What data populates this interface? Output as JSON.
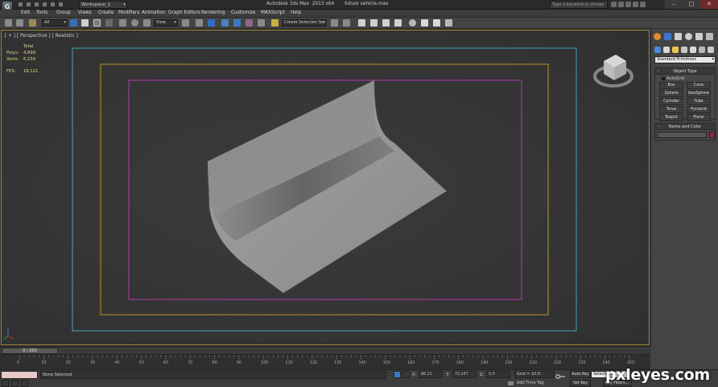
{
  "titlebar": {
    "workspace": "Workspace_1",
    "window_title": "Autodesk 3ds Max  2013 x64       future vehicle.max",
    "help_placeholder": "Type a keyword or phrase",
    "logo_glyph": "G"
  },
  "menu": [
    "Edit",
    "Tools",
    "Group",
    "Views",
    "Create",
    "Modifiers",
    "Animation",
    "Graph Editors",
    "Rendering",
    "Customize",
    "MAXScript",
    "Help"
  ],
  "toolbar": {
    "selection_filter": "All",
    "reference_coord": "View",
    "named_selection_set": "Create Selection Se"
  },
  "viewport": {
    "label": "[ + ] [ Perspective ] [ Realistic ]",
    "stats": [
      {
        "label": "",
        "value": "Total"
      },
      {
        "label": "Polys:",
        "value": "4,899"
      },
      {
        "label": "Verts:",
        "value": "6,156"
      },
      {
        "label": "FPS:",
        "value": "18.121"
      }
    ]
  },
  "command_panel": {
    "category_dropdown": "Standard Primitives",
    "object_type_title": "Object Type",
    "autogrid_label": "AutoGrid",
    "buttons": [
      "Box",
      "Cone",
      "Sphere",
      "GeoSphere",
      "Cylinder",
      "Tube",
      "Torus",
      "Pyramid",
      "Teapot",
      "Plane"
    ],
    "name_color_title": "Name and Color",
    "rollout_sign": "-",
    "swatch_color": "#a0263e"
  },
  "timeline": {
    "frame_readout": "0 / 250",
    "ticks": [
      "0",
      "10",
      "20",
      "30",
      "40",
      "50",
      "60",
      "70",
      "80",
      "90",
      "100",
      "110",
      "120",
      "130",
      "140",
      "150",
      "160",
      "170",
      "180",
      "190",
      "200",
      "210",
      "220",
      "230",
      "240",
      "250"
    ]
  },
  "status": {
    "selection_text": "None Selected",
    "x_label": "X:",
    "x_value": "88.21",
    "y_label": "Y:",
    "y_value": "72.247",
    "z_label": "Z:",
    "z_value": "0.0",
    "grid": "Grid = 10.0",
    "add_time_tag": "Add Time Tag",
    "auto_key": "Auto Key",
    "set_key": "Set Key",
    "key_mode": "Selected",
    "key_filters": "Key Filters..."
  },
  "watermark": "pxleyes.com"
}
